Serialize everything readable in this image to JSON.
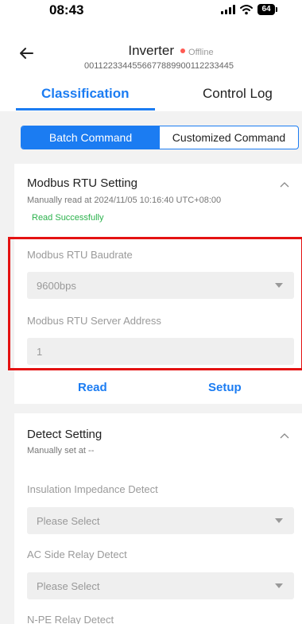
{
  "status_bar": {
    "time": "08:43",
    "battery": "64"
  },
  "header": {
    "device_name": "Inverter",
    "status": "Offline",
    "serial": "0011223344556677889900112233445"
  },
  "tabs": [
    {
      "label": "Classification",
      "active": true
    },
    {
      "label": "Control Log",
      "active": false
    }
  ],
  "segment": {
    "batch_label": "Batch Command",
    "custom_label": "Customized Command",
    "selected": "Batch Command"
  },
  "modbus_section": {
    "title": "Modbus RTU Setting",
    "read_info": "Manually read at 2024/11/05 10:16:40 UTC+08:00",
    "read_status": "Read Successfully",
    "baudrate_label": "Modbus RTU Baudrate",
    "baudrate_value": "9600bps",
    "address_label": "Modbus RTU Server Address",
    "address_value": "1",
    "read_button": "Read",
    "setup_button": "Setup"
  },
  "detect_section": {
    "title": "Detect Setting",
    "set_info": "Manually set at --",
    "insulation_label": "Insulation Impedance Detect",
    "insulation_placeholder": "Please Select",
    "ac_relay_label": "AC Side Relay Detect",
    "ac_relay_placeholder": "Please Select",
    "npe_label": "N-PE Relay Detect"
  },
  "colors": {
    "accent": "#1b7cf2",
    "success": "#2bb24c",
    "offline": "#ff5a52",
    "highlight": "#e41212"
  }
}
